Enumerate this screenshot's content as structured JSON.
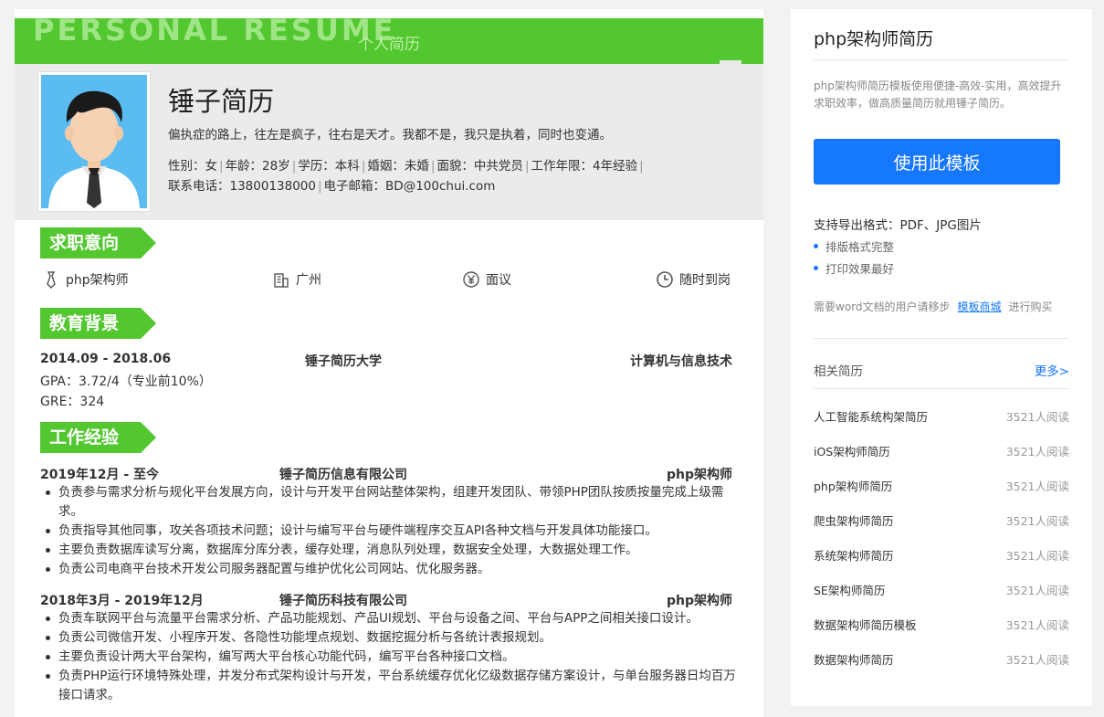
{
  "resume": {
    "banner_title": "PERSONAL RESUME",
    "banner_sub": "个人简历",
    "name": "锤子简历",
    "motto": "偏执症的路上，往左是疯子，往右是天才。我都不是，我只是执着，同时也变通。",
    "info_line1": [
      "性别：女",
      "年龄：28岁",
      "学历：本科",
      "婚姻：未婚",
      "面貌：中共党员",
      "工作年限：4年经验"
    ],
    "info_line2": [
      "联系电话：13800138000",
      "电子邮箱：BD@100chui.com"
    ],
    "sections": {
      "intent": "求职意向",
      "education": "教育背景",
      "work": "工作经验"
    },
    "intent": {
      "position": "php架构师",
      "city": "广州",
      "salary": "面议",
      "availability": "随时到岗"
    },
    "education": {
      "period": "2014.09 - 2018.06",
      "school": "锤子简历大学",
      "major": "计算机与信息技术",
      "gpa": "GPA：3.72/4（专业前10%）",
      "gre": "GRE：324"
    },
    "work": [
      {
        "period": "2019年12月 - 至今",
        "company": "锤子简历信息有限公司",
        "role": "php架构师",
        "duties": [
          "负责参与需求分析与规化平台发展方向，设计与开发平台网站整体架构，组建开发团队、带领PHP团队按质按量完成上级需求。",
          "负责指导其他同事，攻关各项技术问题；设计与编写平台与硬件端程序交互API各种文档与开发具体功能接口。",
          "主要负责数据库读写分离，数据库分库分表，缓存处理，消息队列处理，数据安全处理，大数据处理工作。",
          "负责公司电商平台技术开发公司服务器配置与维护优化公司网站、优化服务器。"
        ]
      },
      {
        "period": "2018年3月 - 2019年12月",
        "company": "锤子简历科技有限公司",
        "role": "php架构师",
        "duties": [
          "负责车联网平台与流量平台需求分析、产品功能规划、产品UI规划、平台与设备之间、平台与APP之间相关接口设计。",
          "负责公司微信开发、小程序开发、各隐性功能埋点规划、数据挖掘分析与各统计表报规划。",
          "主要负责设计两大平台架构，编写两大平台核心功能代码，编写平台各种接口文档。",
          "负责PHP运行环境特殊处理，并发分布式架构设计与开发，平台系统缓存优化亿级数据存储方案设计，与单台服务器日均百万接口请求。"
        ]
      }
    ]
  },
  "sidebar": {
    "title": "php架构师简历",
    "description": "php架构师简历模板使用便捷-高效-实用，高效提升求职效率，做高质量简历就用锤子简历。",
    "use_button": "使用此模板",
    "export_formats": "支持导出格式：PDF、JPG图片",
    "features": [
      "排版格式完整",
      "打印效果最好"
    ],
    "word_note_prefix": "需要word文档的用户请移步",
    "word_note_link": "模板商城",
    "word_note_suffix": "进行购买",
    "related_title": "相关简历",
    "more_link": "更多>",
    "related": [
      {
        "title": "人工智能系统构架简历",
        "reads": "3521人阅读"
      },
      {
        "title": "iOS架构师简历",
        "reads": "3521人阅读"
      },
      {
        "title": "php架构师简历",
        "reads": "3521人阅读"
      },
      {
        "title": "爬虫架构师简历",
        "reads": "3521人阅读"
      },
      {
        "title": "系统架构师简历",
        "reads": "3521人阅读"
      },
      {
        "title": "SE架构师简历",
        "reads": "3521人阅读"
      },
      {
        "title": "数据架构师简历模板",
        "reads": "3521人阅读"
      },
      {
        "title": "数据架构师简历",
        "reads": "3521人阅读"
      }
    ],
    "accent_color": "#1677ff"
  },
  "theme": {
    "resume_green": "#52c72f"
  }
}
